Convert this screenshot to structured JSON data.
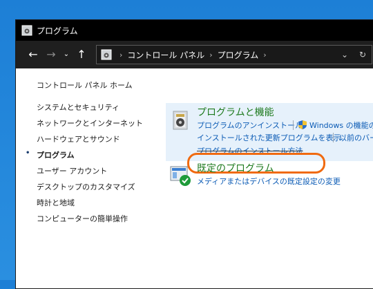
{
  "window": {
    "title": "プログラム"
  },
  "address": {
    "crumbs": [
      "コントロール パネル",
      "プログラム"
    ],
    "sep": "›"
  },
  "nav": {
    "back": "←",
    "forward": "→",
    "recent": "⌄",
    "up": "↑",
    "dropdown": "⌄",
    "refresh": "↻"
  },
  "sidebar": {
    "home": "コントロール パネル ホーム",
    "items": [
      {
        "label": "システムとセキュリティ"
      },
      {
        "label": "ネットワークとインターネット"
      },
      {
        "label": "ハードウェアとサウンド"
      },
      {
        "label": "プログラム",
        "active": true
      },
      {
        "label": "ユーザー アカウント"
      },
      {
        "label": "デスクトップのカスタマイズ"
      },
      {
        "label": "時計と地域"
      },
      {
        "label": "コンピューターの簡単操作"
      }
    ],
    "bullet": "•"
  },
  "programs": {
    "title": "プログラムと機能",
    "uninstall": "プログラムのアンインストール",
    "windows_features": "Windows の機能の",
    "installed_updates": "インストールされた更新プログラムを表示",
    "previous": "以前のバー",
    "install_method": "プログラムのインストール方法"
  },
  "defaults": {
    "title": "既定のプログラム",
    "media_defaults": "メディアまたはデバイスの既定設定の変更"
  },
  "colors": {
    "accent_green": "#1e7a1e",
    "link_blue": "#0b5bb5",
    "callout_orange": "#f06a0f"
  }
}
